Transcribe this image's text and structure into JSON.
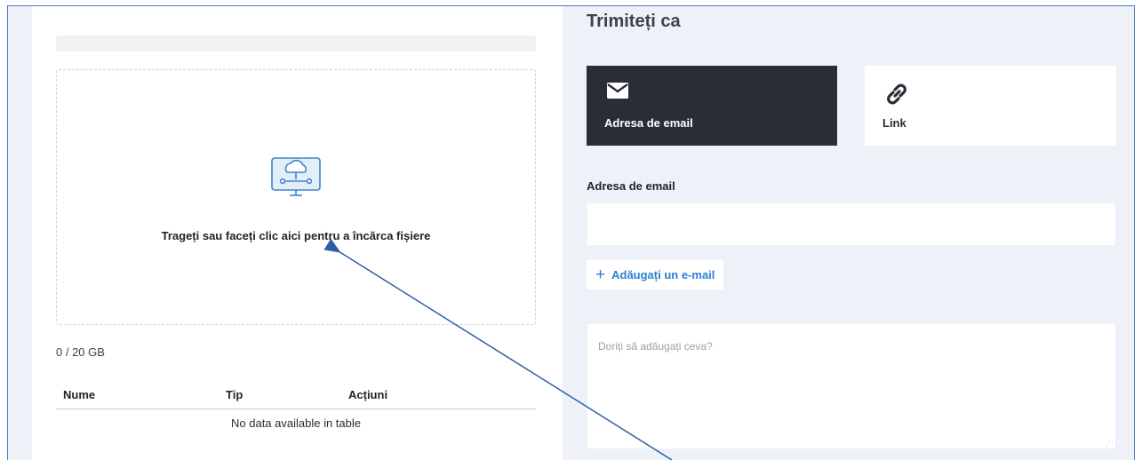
{
  "upload": {
    "dropzone_text": "Trageți sau faceți clic aici pentru a încărca fișiere",
    "storage_usage": "0 / 20 GB",
    "icon": "cloud-upload-monitor-icon"
  },
  "files_table": {
    "columns": [
      "Nume",
      "Tip",
      "Acțiuni"
    ],
    "empty_message": "No data available in table"
  },
  "send": {
    "heading": "Trimiteți ca",
    "modes": [
      {
        "label": "Adresa de email",
        "icon": "envelope-icon",
        "selected": true
      },
      {
        "label": "Link",
        "icon": "link-icon",
        "selected": false
      }
    ],
    "email_label": "Adresa de email",
    "email_value": "",
    "add_email_label": "Adăugați un e-mail",
    "message_placeholder": "Doriți să adăugați ceva?"
  },
  "colors": {
    "accent": "#2c7fd4",
    "selected_card": "#2a2d36",
    "background": "#eef1f7",
    "annotation_arrow": "#2f5ea3",
    "frame_border": "#4a7fc1"
  }
}
